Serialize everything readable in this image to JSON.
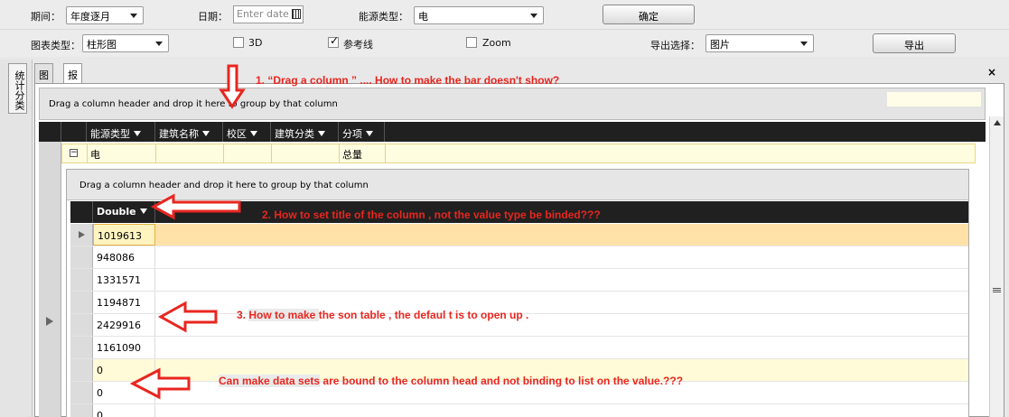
{
  "toolbar1": {
    "period_label": "期间：",
    "period_value": "年度逐月",
    "date_label": "日期：",
    "date_placeholder": "Enter date",
    "energy_label": "能源类型：",
    "energy_value": "电",
    "confirm_label": "确定"
  },
  "toolbar2": {
    "chart_type_label": "图表类型：",
    "chart_type_value": "柱形图",
    "cb_3d": "3D",
    "cb_ref": "参考线",
    "cb_zoom": "Zoom",
    "export_label": "导出选择：",
    "export_value": "图片",
    "export_button": "导出"
  },
  "side_tab": "统计分类",
  "tabs": [
    "图表",
    "报表"
  ],
  "close": "×",
  "group_hint": "Drag a column header and drop it here to group by that column",
  "columns": [
    "能源类型",
    "建筑名称",
    "校区",
    "建筑分类",
    "分项"
  ],
  "group_row": {
    "energy": "电",
    "item": "总量"
  },
  "child": {
    "group_hint": "Drag a column header and drop it here to group by that column",
    "column": "Double",
    "rows": [
      "1019613",
      "948086",
      "1331571",
      "1194871",
      "2429916",
      "1161090",
      "0",
      "0",
      "0"
    ]
  },
  "annotations": {
    "a1": "1.   “Drag a  column ” ....  How to   make  the   bar   doesn't   show?",
    "a2": "2. How to set   title  of  the  column , not  the  value type  be  binded???",
    "a3_pre": "3.  ",
    "a3_hl": " How  to  make ",
    "a3_post": " the  son  table   , the  defaul t is  to  open  up .",
    "a4_hl": "Can make data sets",
    "a4_post": " are bound to the column head and not binding to list on the value.???"
  },
  "colors": {
    "annotation": "#e8261f",
    "header": "#202020",
    "selected_row": "#ffe2a8"
  }
}
